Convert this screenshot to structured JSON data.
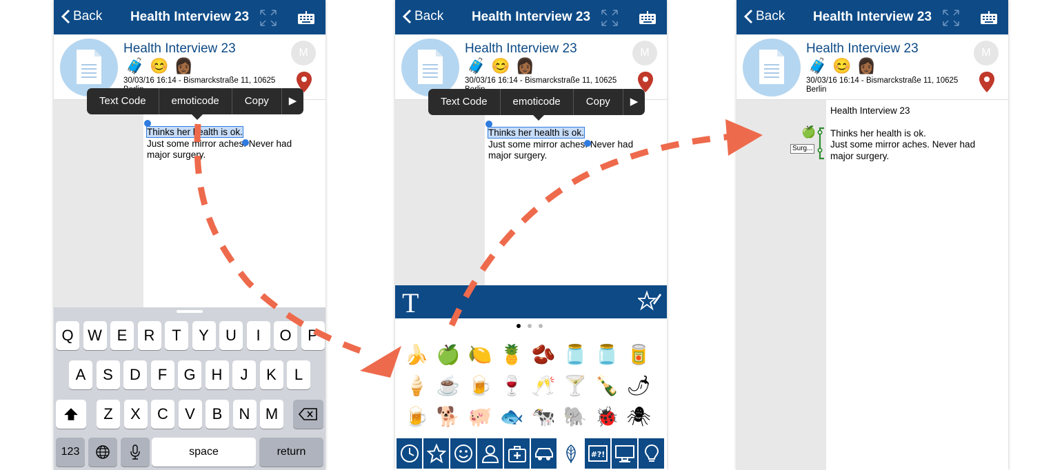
{
  "nav": {
    "back_label": "Back",
    "title": "Health Interview 23"
  },
  "interview": {
    "title": "Health Interview 23",
    "meta_line1": "30/03/16 16:14 - Bismarckstraße 11, 10625",
    "meta_line2": "Berlin",
    "avatar_initial": "M",
    "header_emojis": [
      "🧳",
      "😊",
      "👩🏾"
    ]
  },
  "context_menu": {
    "items": [
      "Text Code",
      "emoticode",
      "Copy",
      "▶"
    ]
  },
  "note": {
    "line1": "Thinks her health is ok.",
    "line2": "Just some mirror aches. Never had",
    "line3": "major surgery.",
    "selected": "Thinks her health is ok."
  },
  "keyboard": {
    "row1": [
      "Q",
      "W",
      "E",
      "R",
      "T",
      "Y",
      "U",
      "I",
      "O",
      "P"
    ],
    "row2": [
      "A",
      "S",
      "D",
      "F",
      "G",
      "H",
      "J",
      "K",
      "L"
    ],
    "row3": [
      "Z",
      "X",
      "C",
      "V",
      "B",
      "N",
      "M"
    ],
    "num_label": "123",
    "space_label": "space",
    "return_label": "return"
  },
  "emoji_panel": {
    "text_mode_label": "T",
    "emojis": [
      "🍌",
      "🍏",
      "🍋",
      "🍍",
      "🫘",
      "🫙",
      "🫙",
      "🥫",
      "🍦",
      "☕",
      "🍺",
      "🍷",
      "🥂",
      "🍸",
      "🍾",
      "🌶",
      "🍺",
      "🐕",
      "🐖",
      "🐟",
      "🐄",
      "🐘",
      "🐞",
      "🕷"
    ],
    "categories": [
      "clock",
      "star",
      "smiley",
      "person",
      "medical",
      "car",
      "leaf",
      "symbols",
      "computer",
      "bulb"
    ]
  },
  "result": {
    "heading": "Health Interview 23",
    "code_label": "Surg..."
  },
  "colors": {
    "brand": "#0d4a86",
    "arrow": "#ee6a4c",
    "code_green": "#2e8b2e"
  }
}
